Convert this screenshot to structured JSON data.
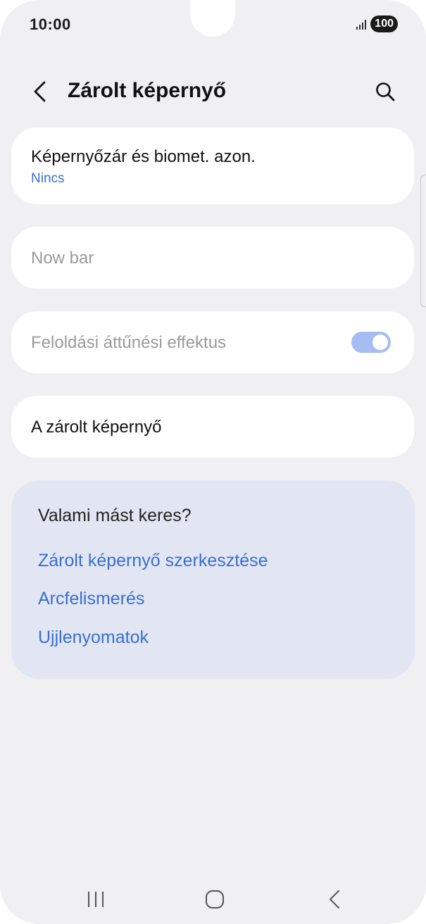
{
  "status_bar": {
    "time": "10:00",
    "battery": "100"
  },
  "header": {
    "title": "Zárolt képernyő",
    "back_icon": "chevron-left-icon",
    "search_icon": "search-icon"
  },
  "settings": {
    "screen_lock": {
      "label": "Képernyőzár és biomet. azon.",
      "value": "Nincs"
    },
    "now_bar": {
      "label": "Now bar",
      "enabled": false
    },
    "unlock_effect": {
      "label": "Feloldási áttűnési effektus",
      "toggle_on": true,
      "enabled": false
    },
    "lock_screen": {
      "label": "A zárolt képernyő"
    }
  },
  "suggestions": {
    "title": "Valami mást keres?",
    "links": [
      "Zárolt képernyő szerkesztése",
      "Arcfelismerés",
      "Ujjlenyomatok"
    ]
  },
  "colors": {
    "background": "#f0f0f3",
    "card": "#ffffff",
    "accent": "#3a6fd0",
    "suggest_bg": "#e2e6f3",
    "toggle": "#a5bdf2"
  }
}
